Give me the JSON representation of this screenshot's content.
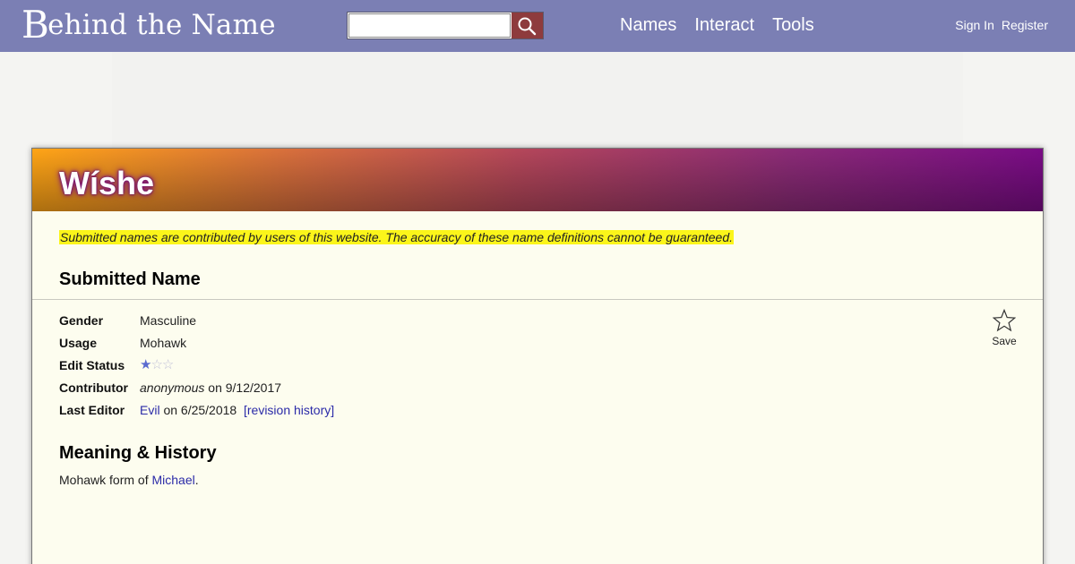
{
  "header": {
    "logo_first": "B",
    "logo_rest": "ehind the Name",
    "search": {
      "placeholder": "",
      "value": ""
    },
    "nav": [
      "Names",
      "Interact",
      "Tools"
    ],
    "user_nav": [
      "Sign In",
      "Register"
    ]
  },
  "name": {
    "title": "Wíshe",
    "notice": "Submitted names are contributed by users of this website. The accuracy of these name definitions cannot be guaranteed.",
    "section_submitted": "Submitted Name",
    "fields": {
      "gender_label": "Gender",
      "gender_value": "Masculine",
      "usage_label": "Usage",
      "usage_value": "Mohawk",
      "edit_status_label": "Edit Status",
      "edit_status_rating": 1,
      "edit_status_max": 3,
      "contributor_label": "Contributor",
      "contributor_name": "anonymous",
      "contributor_on": "on 9/12/2017",
      "last_editor_label": "Last Editor",
      "last_editor_name": "Evil",
      "last_editor_on": "on 6/25/2018",
      "revision_history": "[revision history]"
    },
    "save_label": "Save",
    "section_meaning": "Meaning & History",
    "meaning_prefix": "Mohawk form of ",
    "meaning_link": "Michael",
    "meaning_suffix": "."
  },
  "colors": {
    "header_bg": "#7b7fb4",
    "link": "#2b2ba8",
    "notice_highlight": "#fbf51a",
    "search_button": "#8e3b3d"
  },
  "icons": {
    "search": "search-icon",
    "save": "star-outline-icon",
    "rating": "star-icon"
  }
}
